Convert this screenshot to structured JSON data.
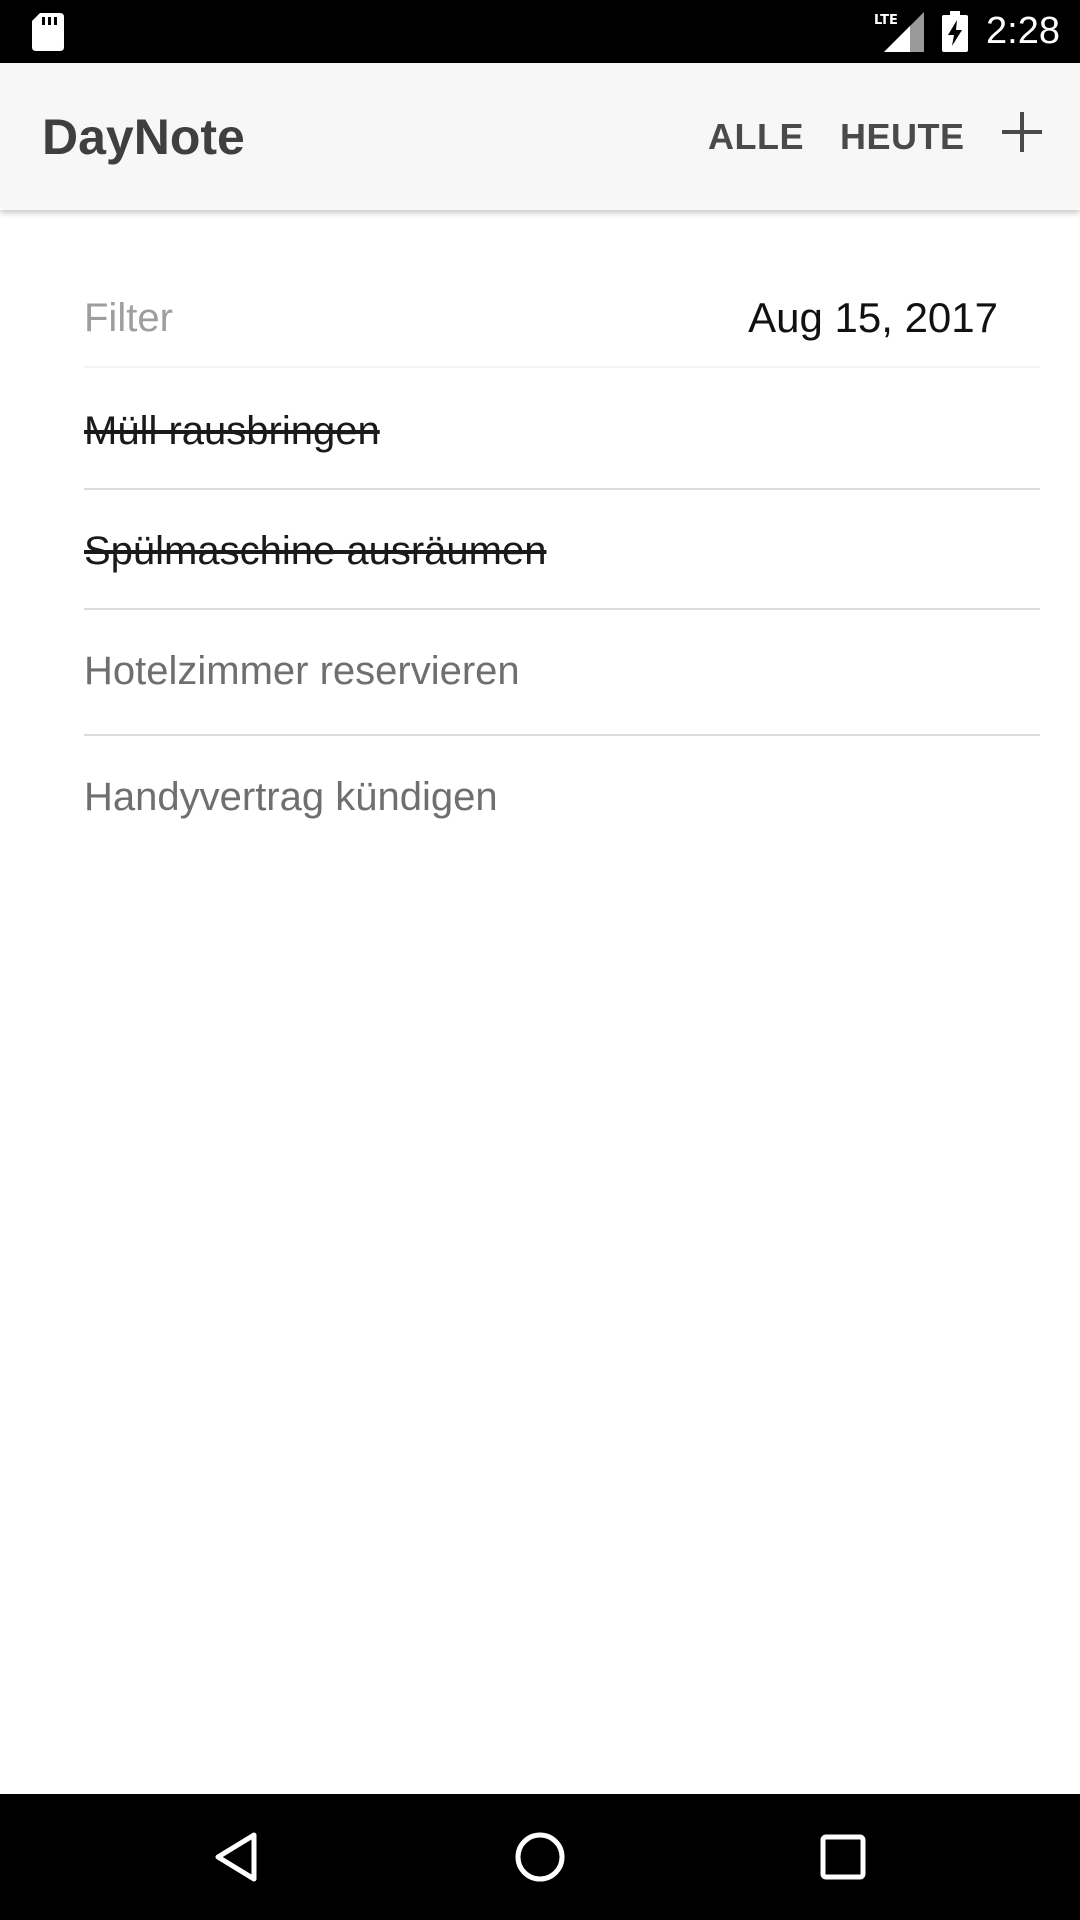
{
  "status_bar": {
    "time": "2:28",
    "network_label": "LTE",
    "icons": [
      "sd-card-icon",
      "lte-signal-icon",
      "battery-charging-icon"
    ]
  },
  "app_bar": {
    "title": "DayNote",
    "actions": {
      "all_label": "ALLE",
      "today_label": "HEUTE",
      "add_icon": "plus-icon"
    }
  },
  "filter": {
    "placeholder": "Filter",
    "value": "",
    "date": "Aug 15, 2017"
  },
  "tasks": [
    {
      "text": "Müll rausbringen",
      "done": true
    },
    {
      "text": "Spülmaschine ausräumen",
      "done": true
    },
    {
      "text": "Hotelzimmer reservieren",
      "done": false
    },
    {
      "text": "Handyvertrag kündigen",
      "done": false
    }
  ],
  "nav_bar": {
    "icons": [
      "back-triangle-icon",
      "home-circle-icon",
      "recents-square-icon"
    ]
  },
  "colors": {
    "app_bar_bg": "#f7f7f7",
    "title_text": "#3f3f3f",
    "done_text": "#1a1a1a",
    "open_text": "#6f6f6f",
    "divider": "#dcdcdc",
    "system_bars": "#000000"
  }
}
